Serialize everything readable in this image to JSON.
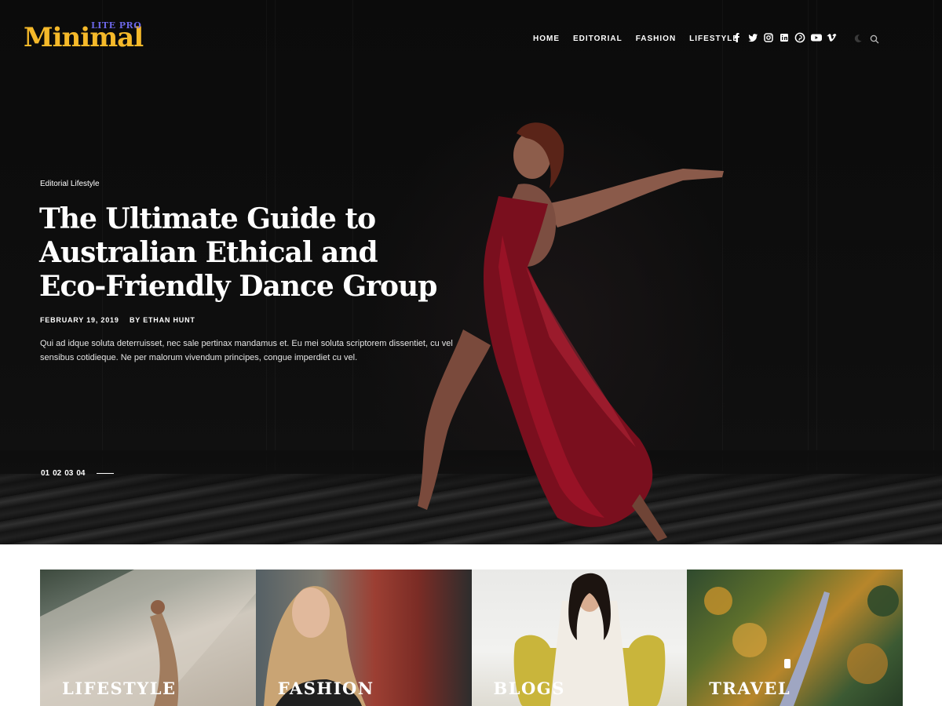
{
  "brand": {
    "name": "Minimal",
    "tag": "LITE PRO",
    "name_color": "#f5b92a",
    "tag_color": "#6b66e6"
  },
  "nav": {
    "items": [
      "HOME",
      "EDITORIAL",
      "FASHION",
      "LIFESTYLE"
    ]
  },
  "social": {
    "icons": [
      "facebook-icon",
      "twitter-icon",
      "instagram-icon",
      "linkedin-icon",
      "pinterest-icon",
      "youtube-icon",
      "vimeo-icon"
    ]
  },
  "utility": {
    "icons": [
      "moon-icon",
      "search-icon"
    ]
  },
  "hero": {
    "category": "Editorial Lifestyle",
    "title": "The Ultimate Guide to Australian Ethical and Eco-Friendly Dance Group",
    "date": "FEBRUARY 19, 2019",
    "author": "BY ETHAN HUNT",
    "excerpt": "Qui ad idque soluta deterruisset, nec sale pertinax mandamus et. Eu mei soluta scriptorem dissentiet, cu vel sensibus cotidieque. Ne per malorum vivendum principes, congue imperdiet cu vel.",
    "slides": [
      "01",
      "02",
      "03",
      "04"
    ]
  },
  "categories": [
    {
      "label": "LIFESTYLE"
    },
    {
      "label": "FASHION"
    },
    {
      "label": "BLOGS"
    },
    {
      "label": "TRAVEL"
    }
  ]
}
